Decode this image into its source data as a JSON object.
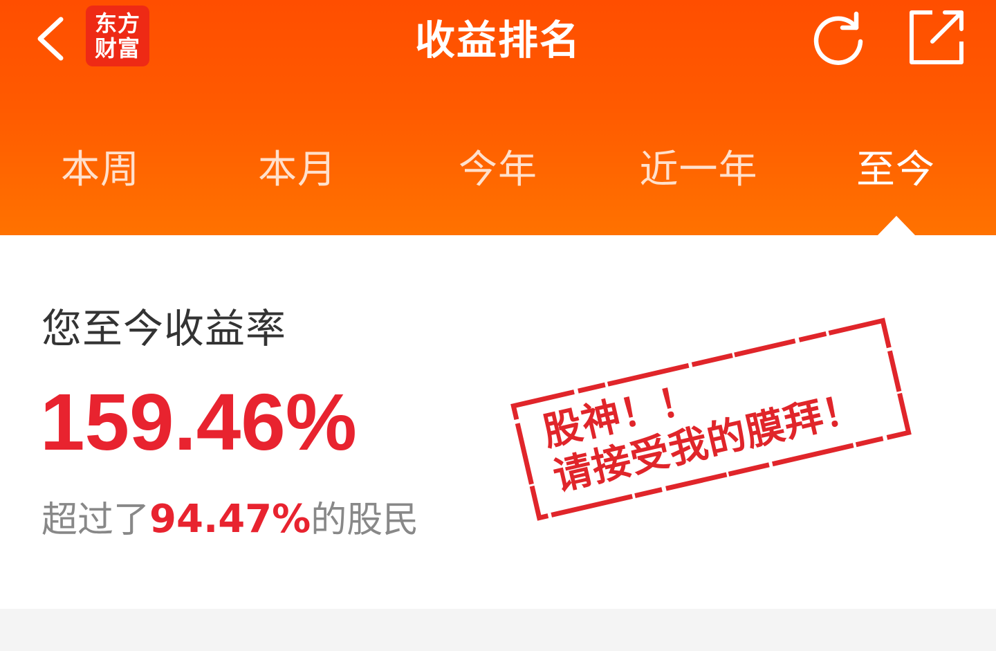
{
  "header": {
    "title": "收益排名",
    "logo_line1": "东方",
    "logo_line2": "财富",
    "colors": {
      "gradient_top": "#ff4e00",
      "gradient_bottom": "#ff7200",
      "logo_bg": "#ee2a15"
    },
    "icons": [
      "chevron-left-icon",
      "refresh-icon",
      "share-icon"
    ]
  },
  "tabs": [
    {
      "label": "本周",
      "active": false
    },
    {
      "label": "本月",
      "active": false
    },
    {
      "label": "今年",
      "active": false
    },
    {
      "label": "近一年",
      "active": false
    },
    {
      "label": "至今",
      "active": true
    }
  ],
  "result": {
    "label": "您至今收益率",
    "rate": "159.46%",
    "beat_prefix": "超过了",
    "beat_percent": "94.47%",
    "beat_suffix": "的股民"
  },
  "stamp": {
    "line1": "股神！！",
    "line2": "请接受我的膜拜！",
    "color": "#e0252a"
  },
  "colors": {
    "accent_red": "#e8232f",
    "label_gray": "#888888"
  }
}
